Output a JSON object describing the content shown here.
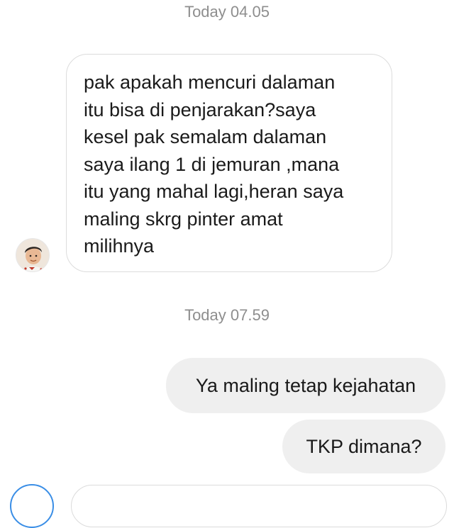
{
  "timestamps": [
    "Today 04.05",
    "Today 07.59"
  ],
  "incoming_message": {
    "lines": [
      "pak apakah mencuri dalaman",
      "itu bisa di penjarakan?saya",
      "kesel pak semalam dalaman",
      "saya ilang 1 di jemuran ,mana",
      "itu yang mahal lagi,heran saya",
      "maling skrg pinter amat",
      "milihnya"
    ]
  },
  "outgoing_messages": [
    "Ya maling tetap kejahatan",
    "TKP dimana?"
  ],
  "icons": {
    "avatar": "child-profile-photo",
    "composer": "camera-icon"
  },
  "colors": {
    "background": "#ffffff",
    "outgoing_bubble": "#efefef",
    "incoming_border": "#dcdcdc",
    "timestamp": "#8e8e8e",
    "composer_accent": "#3a8ee6"
  }
}
